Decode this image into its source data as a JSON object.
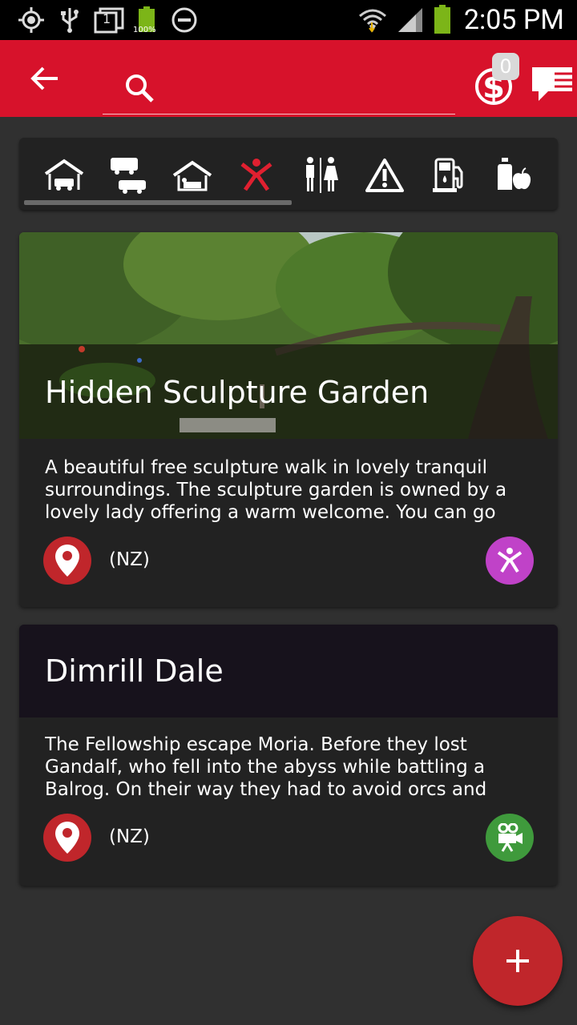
{
  "status_bar": {
    "time": "2:05 PM",
    "battery_label": "100%",
    "sim_label": "1"
  },
  "app_bar": {
    "search": {
      "value": "",
      "placeholder": ""
    },
    "money_badge_count": "0"
  },
  "categories": [
    {
      "name": "campground",
      "active": false
    },
    {
      "name": "motorhome",
      "active": false
    },
    {
      "name": "accommodation",
      "active": false
    },
    {
      "name": "activities",
      "active": true
    },
    {
      "name": "toilets",
      "active": false
    },
    {
      "name": "warning",
      "active": false
    },
    {
      "name": "fuel",
      "active": false
    },
    {
      "name": "groceries",
      "active": false
    }
  ],
  "cards": [
    {
      "title": "Hidden Sculpture Garden",
      "description": "A beautiful free sculpture walk in lovely tranquil surroundings. The sculpture garden is owned by a lovely lady offering a warm welcome. You can go and",
      "region": "(NZ)",
      "category_icon": "activity-person-icon",
      "category_color": "#c042c8",
      "has_image": true
    },
    {
      "title": "Dimrill Dale",
      "description": "The Fellowship escape Moria. Before they lost Gandalf, who fell into the abyss while battling a Balrog. On their way they had to avoid orcs and other evil creatures that",
      "region": "(NZ)",
      "category_icon": "movie-camera-icon",
      "category_color": "#3f9a3c",
      "has_image": false
    }
  ],
  "colors": {
    "app_bar": "#d7122b",
    "background": "#303030",
    "card": "#222222",
    "accent": "#c0262b",
    "active_category": "#e02030"
  }
}
